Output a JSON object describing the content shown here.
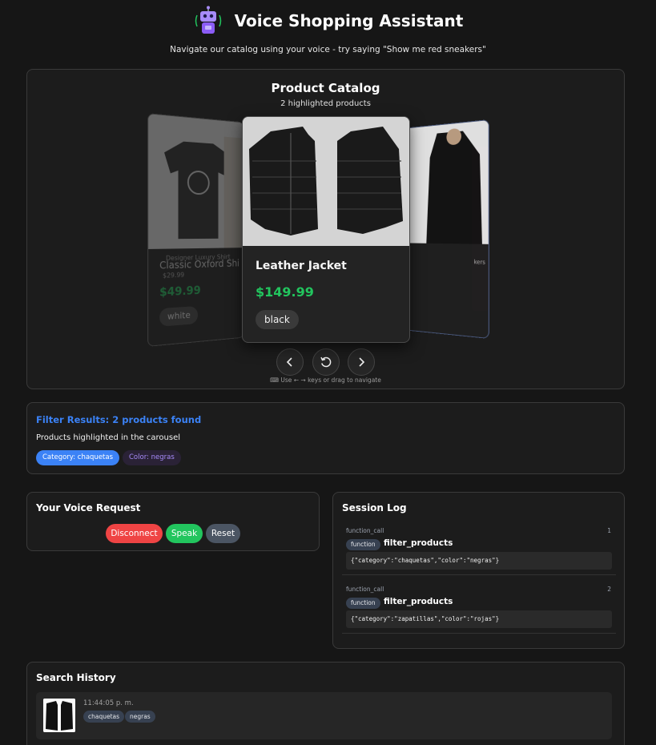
{
  "header": {
    "title": "Voice Shopping Assistant",
    "subtitle": "Navigate our catalog using your voice - try saying \"Show me red sneakers\"",
    "logo_icon": "robot-icon"
  },
  "catalog": {
    "title": "Product Catalog",
    "subtitle": "2 highlighted products",
    "cards": {
      "left": {
        "brand": "Designer Luxury Shirt",
        "name": "Classic Oxford Shi",
        "small_price": "$29.99",
        "price": "$49.99",
        "color": "white"
      },
      "main": {
        "name": "Leather Jacket",
        "price": "$149.99",
        "color": "black"
      },
      "right": {
        "name_fragment": "kers"
      }
    },
    "nav": {
      "prev_icon": "chevron-left-icon",
      "reset_icon": "rotate-ccw-icon",
      "next_icon": "chevron-right-icon"
    },
    "hint": "⌨ Use ← → keys or drag to navigate"
  },
  "filter": {
    "title": "Filter Results: 2 products found",
    "description": "Products highlighted in the carousel",
    "chips": [
      "Category: chaquetas",
      "Color: negras"
    ],
    "colors": {
      "title": "#3b82f6",
      "category_chip": "#3b82f6",
      "color_chip_text": "#a78bfa"
    }
  },
  "voice": {
    "title": "Your Voice Request",
    "buttons": {
      "disconnect": "Disconnect",
      "speak": "Speak",
      "reset": "Reset"
    },
    "colors": {
      "disconnect": "#ef4444",
      "speak": "#22c55e",
      "reset": "#4b5563"
    }
  },
  "log": {
    "title": "Session Log",
    "entries": [
      {
        "type": "function_call",
        "index": "1",
        "badge": "function",
        "name": "filter_products",
        "args": "{\"category\":\"chaquetas\",\"color\":\"negras\"}"
      },
      {
        "type": "function_call",
        "index": "2",
        "badge": "function",
        "name": "filter_products",
        "args": "{\"category\":\"zapatillas\",\"color\":\"rojas\"}"
      }
    ]
  },
  "history": {
    "title": "Search History",
    "items": [
      {
        "time": "11:44:05 p. m.",
        "tags": [
          "chaquetas",
          "negras"
        ]
      }
    ]
  },
  "colors": {
    "price": "#22c55e",
    "background": "#161616",
    "panel": "#1c1c1c"
  }
}
